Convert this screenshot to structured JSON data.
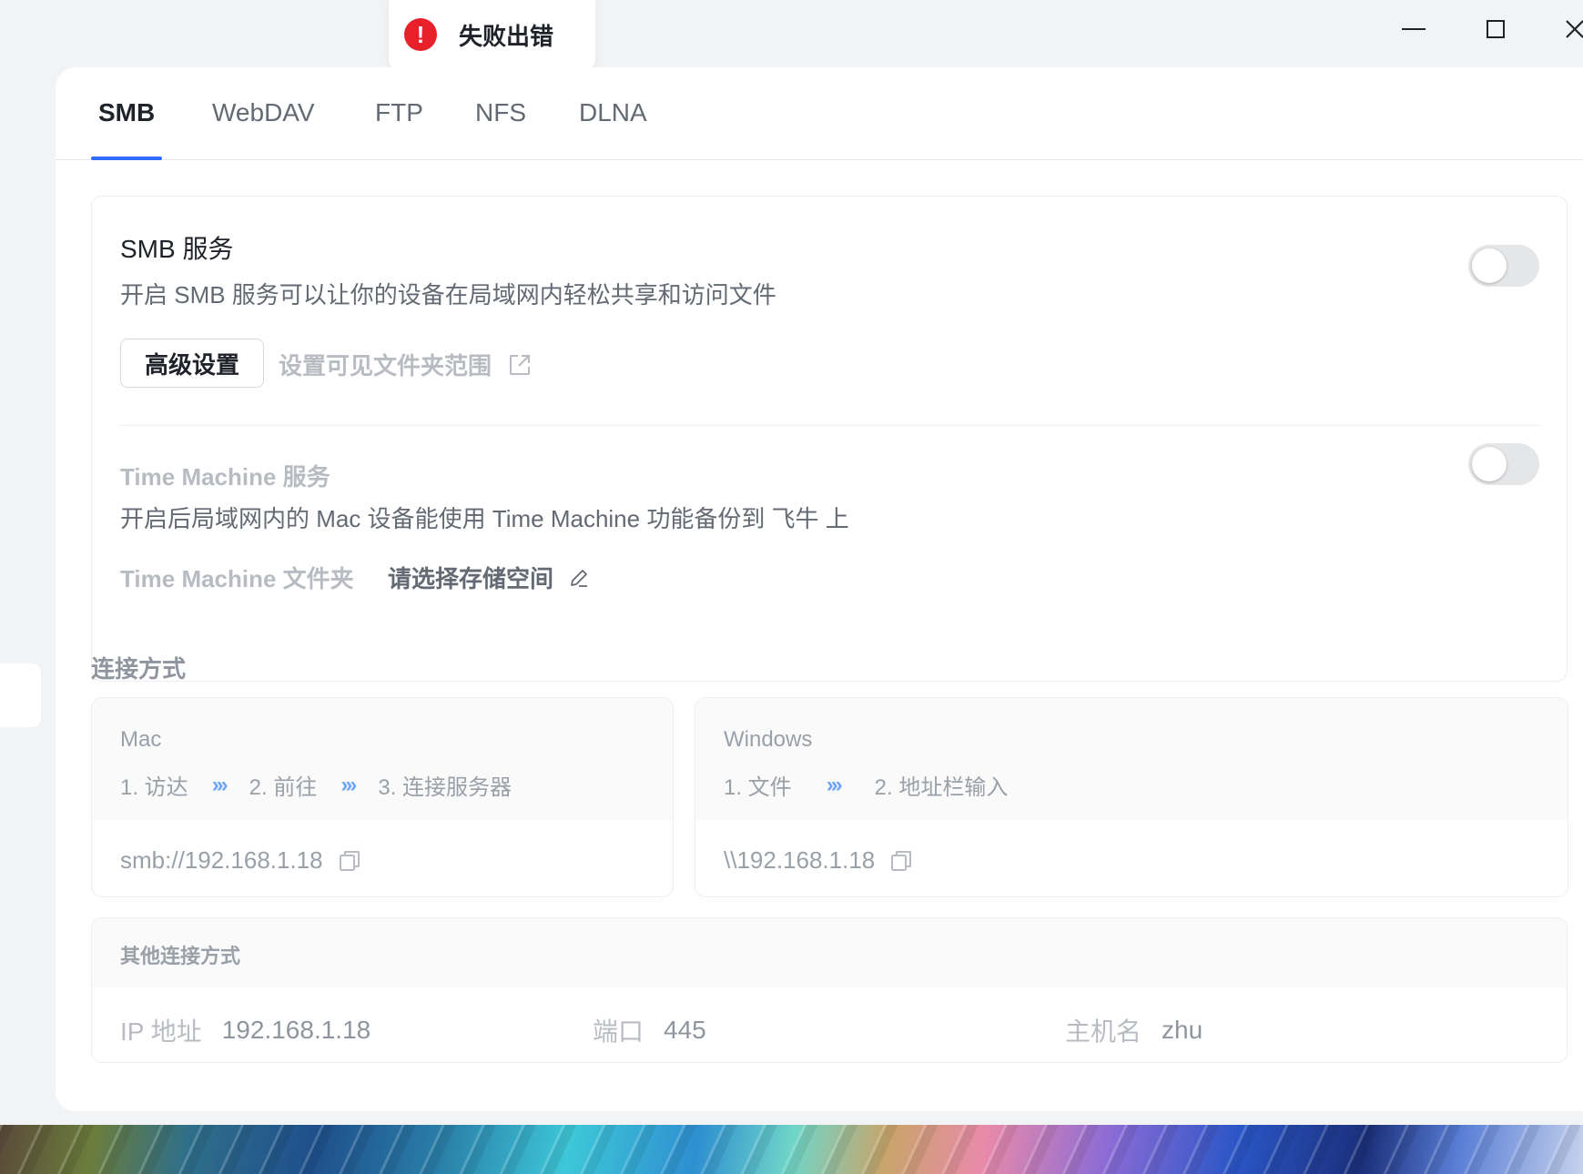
{
  "toast": {
    "icon": "!",
    "message": "失败出错"
  },
  "window_controls": {
    "minimize": "minimize-icon",
    "maximize": "maximize-icon",
    "close": "close-icon"
  },
  "tabs": [
    {
      "label": "SMB",
      "active": true
    },
    {
      "label": "WebDAV",
      "active": false
    },
    {
      "label": "FTP",
      "active": false
    },
    {
      "label": "NFS",
      "active": false
    },
    {
      "label": "DLNA",
      "active": false
    }
  ],
  "smb": {
    "title": "SMB 服务",
    "description": "开启 SMB 服务可以让你的设备在局域网内轻松共享和访问文件",
    "enabled": false,
    "advanced_button": "高级设置",
    "scope_link": "设置可见文件夹范围"
  },
  "time_machine": {
    "title": "Time Machine 服务",
    "description": "开启后局域网内的 Mac 设备能使用 Time Machine 功能备份到 飞牛 上",
    "enabled": false,
    "folder_label": "Time Machine 文件夹",
    "folder_value": "请选择存储空间"
  },
  "connection": {
    "section_title": "连接方式",
    "mac": {
      "os": "Mac",
      "steps": [
        "1. 访达",
        "2. 前往",
        "3. 连接服务器"
      ],
      "address": "smb://192.168.1.18"
    },
    "windows": {
      "os": "Windows",
      "steps": [
        "1. 文件",
        "2. 地址栏输入"
      ],
      "address": "\\\\192.168.1.18"
    },
    "arrow": "›››"
  },
  "other": {
    "title": "其他连接方式",
    "ip_label": "IP 地址",
    "ip_value": "192.168.1.18",
    "port_label": "端口",
    "port_value": "445",
    "host_label": "主机名",
    "host_value": "zhu"
  },
  "colors": {
    "accent": "#2c6cf6",
    "error": "#e8202a",
    "toggle_off": "#e5e6e8"
  }
}
